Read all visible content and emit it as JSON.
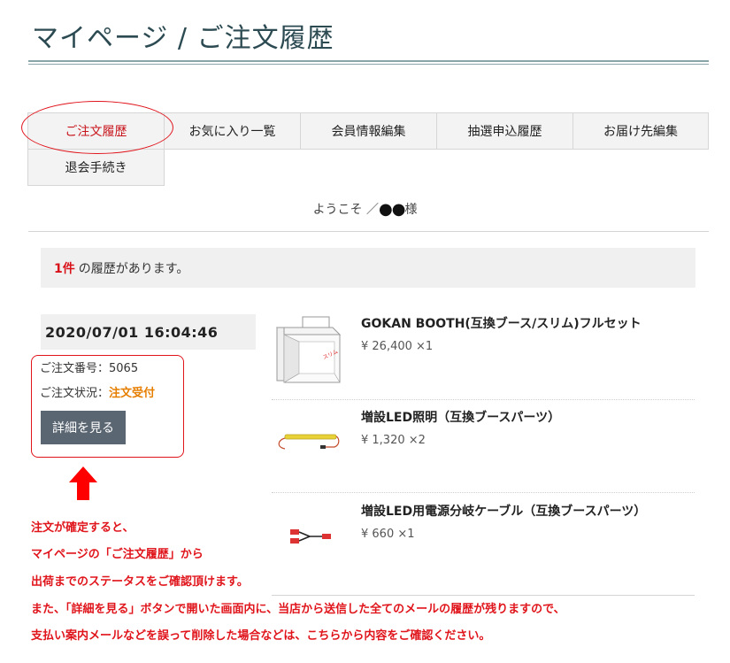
{
  "page_title": "マイページ / ご注文履歴",
  "tabs": [
    {
      "label": "ご注文履歴",
      "active": true
    },
    {
      "label": "お気に入り一覧"
    },
    {
      "label": "会員情報編集"
    },
    {
      "label": "抽選申込履歴"
    },
    {
      "label": "お届け先編集"
    },
    {
      "label": "退会手続き"
    }
  ],
  "welcome": {
    "prefix": "ようこそ ／",
    "name": "●●",
    "suffix": "様"
  },
  "history": {
    "count": "1件",
    "text": " の履歴があります。"
  },
  "order": {
    "date": "2020/07/01 16:04:46",
    "number_label": "ご注文番号：",
    "number": "5065",
    "status_label": "ご注文状況：",
    "status": "注文受付",
    "detail_button": "詳細を見る"
  },
  "products": [
    {
      "name": "GOKAN BOOTH(互換ブース/スリム)フルセット",
      "price": "¥ 26,400 ×1",
      "icon": "booth-image"
    },
    {
      "name": "増設LED照明（互換ブースパーツ）",
      "price": "¥ 1,320 ×2",
      "icon": "led-light-image"
    },
    {
      "name": "増設LED用電源分岐ケーブル（互換ブースパーツ）",
      "price": "¥ 660 ×1",
      "icon": "cable-image"
    }
  ],
  "notes": [
    "注文が確定すると、",
    "マイページの「ご注文履歴」から",
    "出荷までのステータスをご確認頂けます。",
    "また、「詳細を見る」ボタンで開いた画面内に、当店から送信した全てのメールの履歴が残りますので、",
    "支払い案内メールなどを誤って削除した場合などは、こちらから内容をご確認ください。"
  ],
  "colors": {
    "accent_red": "#e0141b",
    "status_orange": "#e67e00",
    "button": "#5a6672",
    "title": "#2c4a52"
  }
}
